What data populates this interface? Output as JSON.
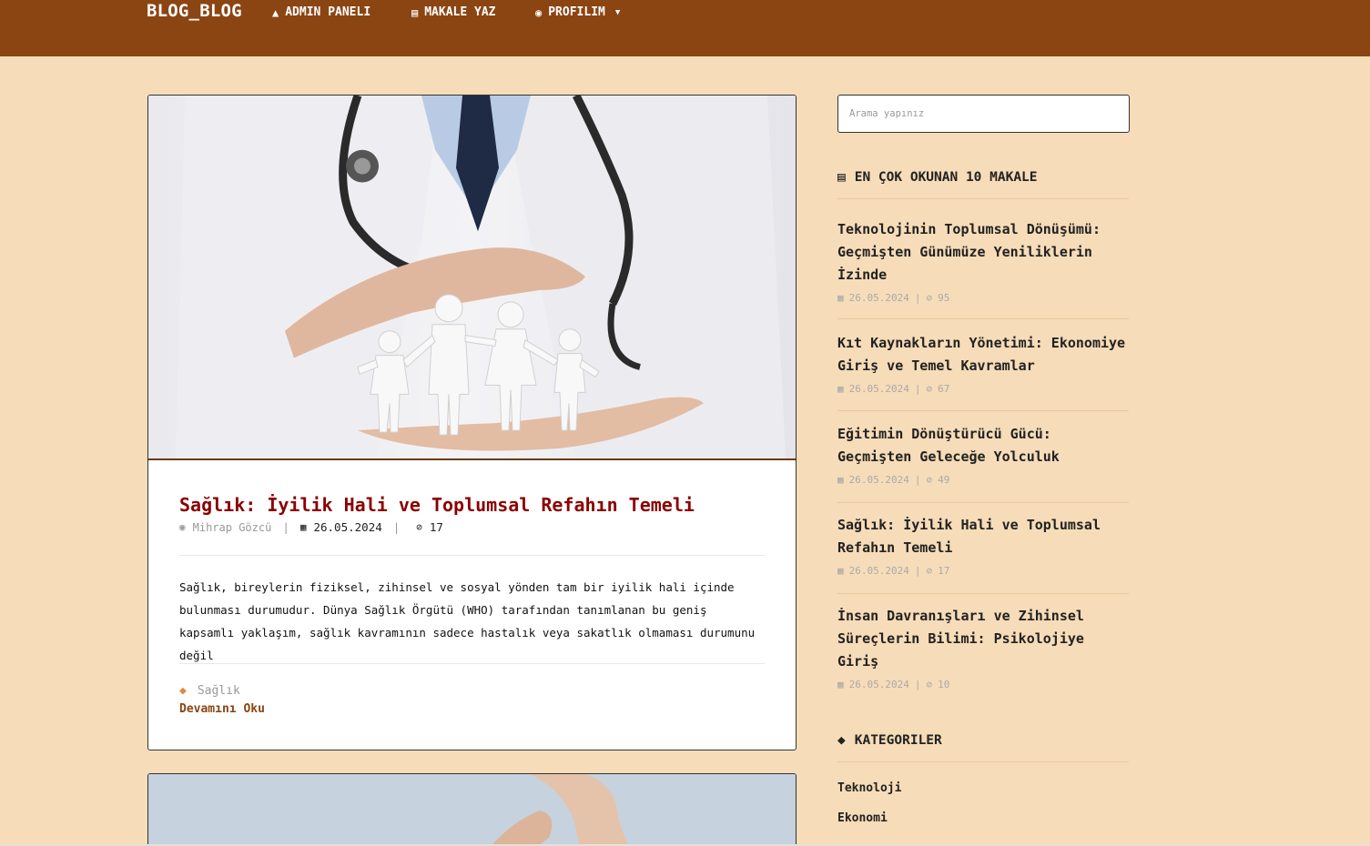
{
  "nav": {
    "brand": "BLOG_BLOG",
    "admin": "ADMIN PANELI",
    "write": "MAKALE YAZ",
    "profile": "PROFILIM"
  },
  "post": {
    "title": "Sağlık: İyilik Hali ve Toplumsal Refahın Temeli",
    "author": "Mihrap Gözcü",
    "date": "26.05.2024",
    "views": "17",
    "excerpt": "Sağlık, bireylerin fiziksel, zihinsel ve sosyal yönden tam bir iyilik hali içinde bulunması durumudur. Dünya Sağlık Örgütü (WHO) tarafından tanımlanan bu geniş kapsamlı yaklaşım, sağlık kavramının sadece hastalık veya sakatlık olmaması durumunu değil",
    "tag": "Sağlık",
    "read_more": "Devamını Oku"
  },
  "search": {
    "placeholder": "Arama yapınız"
  },
  "popular": {
    "heading": "EN ÇOK OKUNAN 10 MAKALE",
    "items": [
      {
        "title": "Teknolojinin Toplumsal Dönüşümü: Geçmişten Günümüze Yeniliklerin İzinde",
        "date": "26.05.2024",
        "views": "95"
      },
      {
        "title": "Kıt Kaynakların Yönetimi: Ekonomiye Giriş ve Temel Kavramlar",
        "date": "26.05.2024",
        "views": "67"
      },
      {
        "title": "Eğitimin Dönüştürücü Gücü: Geçmişten Geleceğe Yolculuk",
        "date": "26.05.2024",
        "views": "49"
      },
      {
        "title": "Sağlık: İyilik Hali ve Toplumsal Refahın Temeli",
        "date": "26.05.2024",
        "views": "17"
      },
      {
        "title": "İnsan Davranışları ve Zihinsel Süreçlerin Bilimi: Psikolojiye Giriş",
        "date": "26.05.2024",
        "views": "10"
      }
    ]
  },
  "categories": {
    "heading": "KATEGORILER",
    "items": [
      "Teknoloji",
      "Ekonomi"
    ]
  },
  "icons": {
    "admin": "home-icon",
    "write": "book-icon",
    "profile": "user-circle-icon",
    "date": "calendar-icon",
    "views": "eye-slash-icon",
    "tag": "tag-icon"
  },
  "colors": {
    "navbar": "#8b4513",
    "page_bg": "#f6dcb8",
    "post_title": "#8b0000",
    "link": "#8b4513",
    "tag_icon": "#e08a3c"
  }
}
